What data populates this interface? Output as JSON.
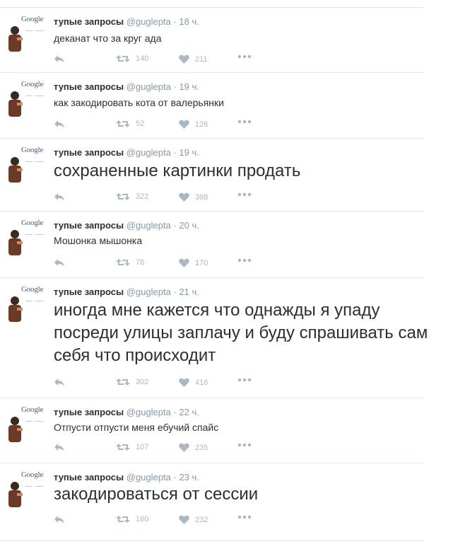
{
  "tweets": [
    {
      "name": "тупые запросы",
      "handle": "@guglepta",
      "time": "18 ч.",
      "text": "деканат что за круг ада",
      "size": "small",
      "retweets": "140",
      "likes": "211"
    },
    {
      "name": "тупые запросы",
      "handle": "@guglepta",
      "time": "19 ч.",
      "text": "как закодировать кота от валерьянки",
      "size": "small",
      "retweets": "52",
      "likes": "126"
    },
    {
      "name": "тупые запросы",
      "handle": "@guglepta",
      "time": "19 ч.",
      "text": "сохраненные картинки продать",
      "size": "big",
      "retweets": "322",
      "likes": "388"
    },
    {
      "name": "тупые запросы",
      "handle": "@guglepta",
      "time": "20 ч.",
      "text": "Мошонка мышонка",
      "size": "small",
      "retweets": "78",
      "likes": "170"
    },
    {
      "name": "тупые запросы",
      "handle": "@guglepta",
      "time": "21 ч.",
      "text": "иногда мне кажется что однажды я упаду посреди улицы заплачу и буду спрашивать сам себя что происходит",
      "size": "big",
      "retweets": "302",
      "likes": "416"
    },
    {
      "name": "тупые запросы",
      "handle": "@guglepta",
      "time": "22 ч.",
      "text": "Отпусти отпусти меня ебучий спайс",
      "size": "small",
      "retweets": "107",
      "likes": "235"
    },
    {
      "name": "тупые запросы",
      "handle": "@guglepta",
      "time": "23 ч.",
      "text": "закодироваться от сессии",
      "size": "big",
      "retweets": "160",
      "likes": "232"
    }
  ],
  "avatar_logo": "Google",
  "separator": " · ",
  "colors": {
    "text": "#292f33",
    "meta": "#8899a6",
    "action": "#aab8c2",
    "border": "#e1e8ed"
  },
  "icons": {
    "reply": "reply-icon",
    "retweet": "retweet-icon",
    "like": "heart-icon",
    "more": "more-dots-icon"
  }
}
